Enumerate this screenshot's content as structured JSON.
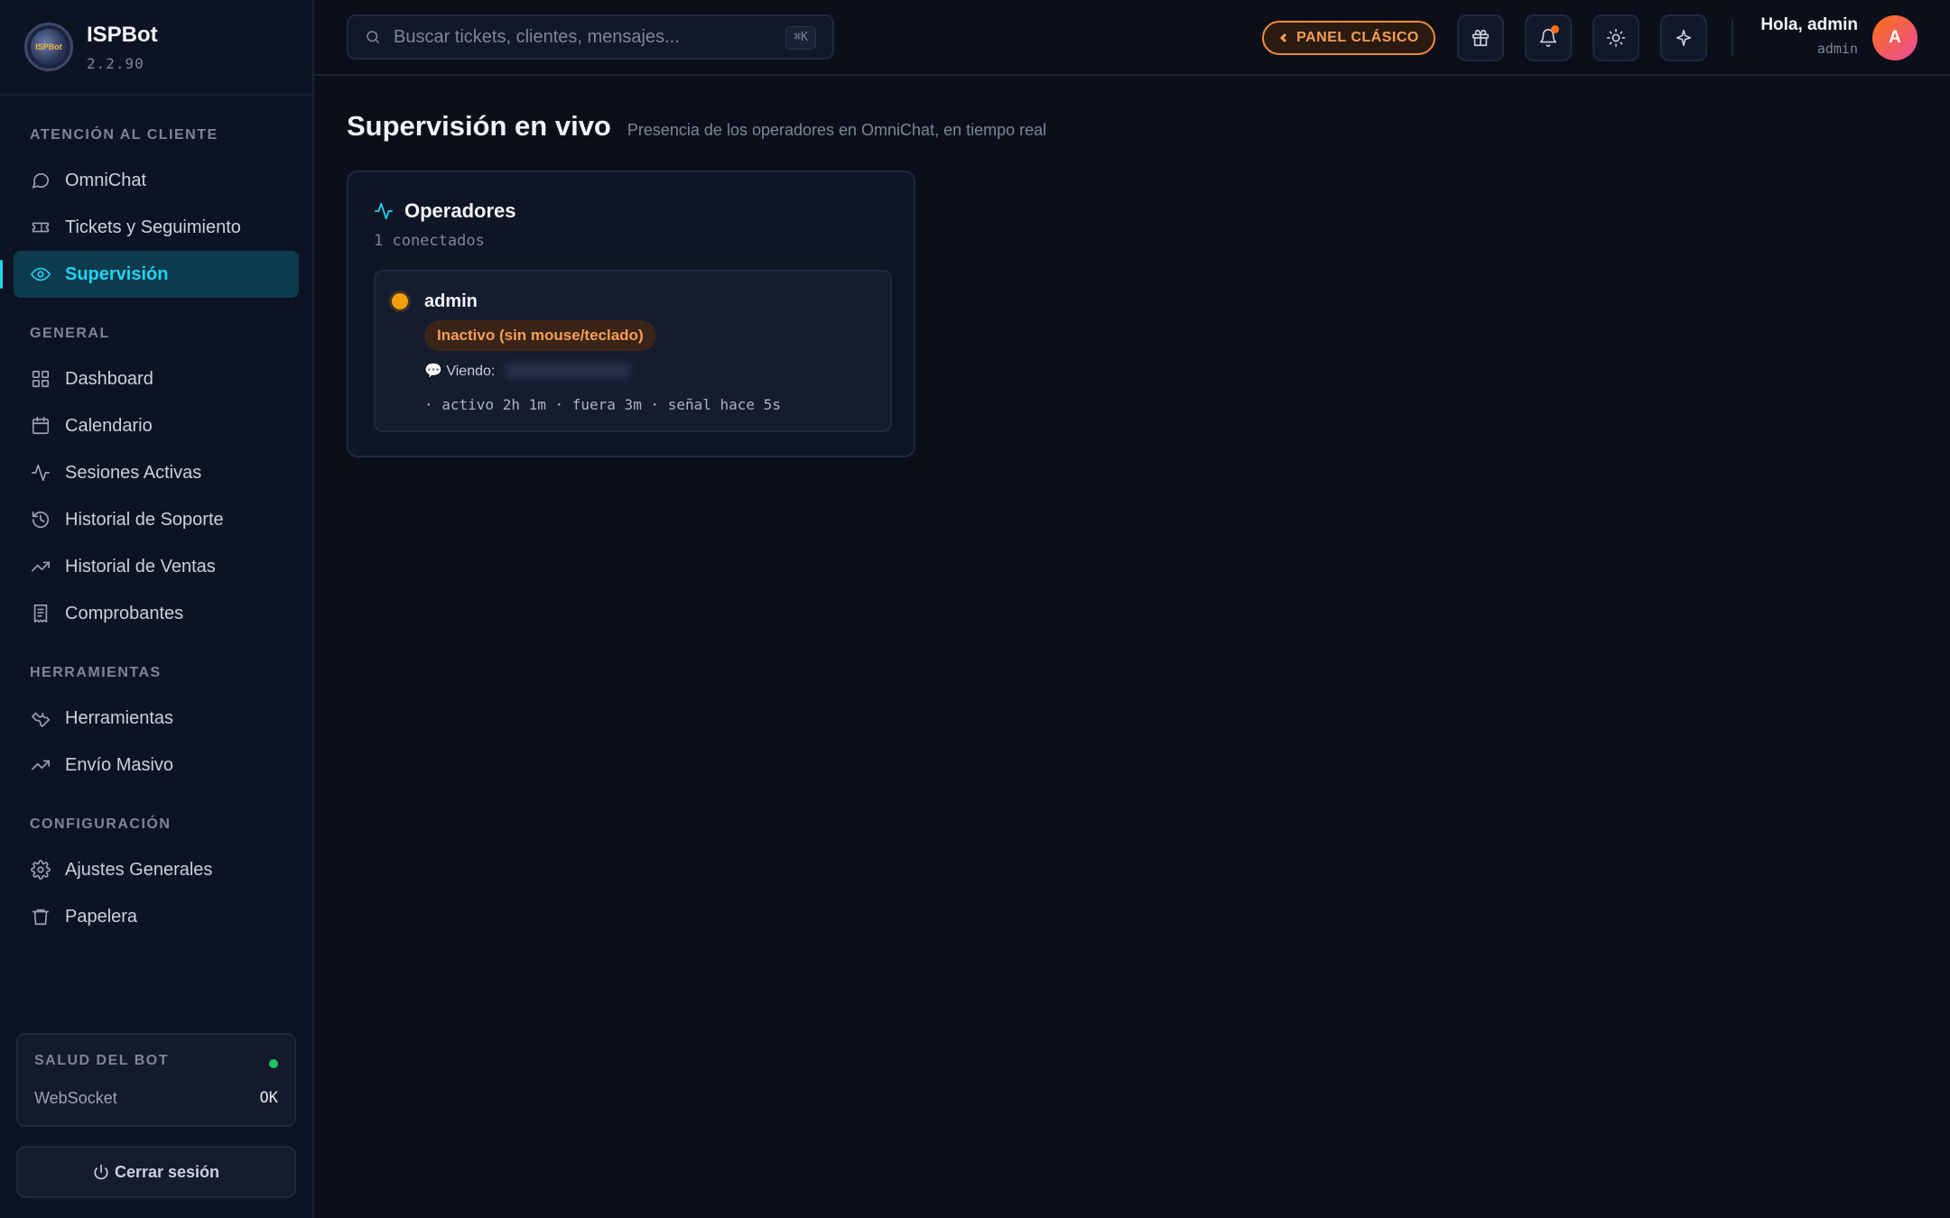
{
  "brand": {
    "name": "ISPBot",
    "version": "2.2.90",
    "logo_text": "ISPBot"
  },
  "sidebar": {
    "sections": [
      {
        "title": "ATENCIÓN AL CLIENTE"
      },
      {
        "title": "GENERAL"
      },
      {
        "title": "HERRAMIENTAS"
      },
      {
        "title": "CONFIGURACIÓN"
      }
    ],
    "items": [
      {
        "label": "OmniChat",
        "icon": "chat-icon"
      },
      {
        "label": "Tickets y Seguimiento",
        "icon": "ticket-icon"
      },
      {
        "label": "Supervisión",
        "icon": "eye-icon",
        "active": true
      },
      {
        "label": "Dashboard",
        "icon": "grid-icon"
      },
      {
        "label": "Calendario",
        "icon": "calendar-icon"
      },
      {
        "label": "Sesiones Activas",
        "icon": "activity-icon"
      },
      {
        "label": "Historial de Soporte",
        "icon": "history-icon"
      },
      {
        "label": "Historial de Ventas",
        "icon": "trending-icon"
      },
      {
        "label": "Comprobantes",
        "icon": "receipt-icon"
      },
      {
        "label": "Herramientas",
        "icon": "wrench-icon"
      },
      {
        "label": "Envío Masivo",
        "icon": "trending-icon"
      },
      {
        "label": "Ajustes Generales",
        "icon": "gear-icon"
      },
      {
        "label": "Papelera",
        "icon": "trash-icon"
      }
    ],
    "health": {
      "title": "SALUD DEL BOT",
      "label": "WebSocket",
      "value": "OK",
      "status_color": "#22c55e"
    },
    "logout_label": "Cerrar sesión"
  },
  "topbar": {
    "search_placeholder": "Buscar tickets, clientes, mensajes...",
    "search_shortcut": "⌘K",
    "classic_label": "PANEL CLÁSICO",
    "user_greeting": "Hola, admin",
    "user_role": "admin",
    "avatar_initial": "A"
  },
  "page": {
    "title": "Supervisión en vivo",
    "subtitle": "Presencia de los operadores en OmniChat, en tiempo real"
  },
  "operators": {
    "title": "Operadores",
    "count_text": "1 conectados",
    "list": [
      {
        "name": "admin",
        "status": "Inactivo (sin mouse/teclado)",
        "viewing_label": "💬 Viendo:",
        "meta": "· activo 2h 1m · fuera 3m · señal hace 5s",
        "status_color": "#f59e0b"
      }
    ]
  },
  "colors": {
    "accent": "#22d3ee",
    "warning": "#f59e52",
    "background": "#0b0f1a"
  }
}
